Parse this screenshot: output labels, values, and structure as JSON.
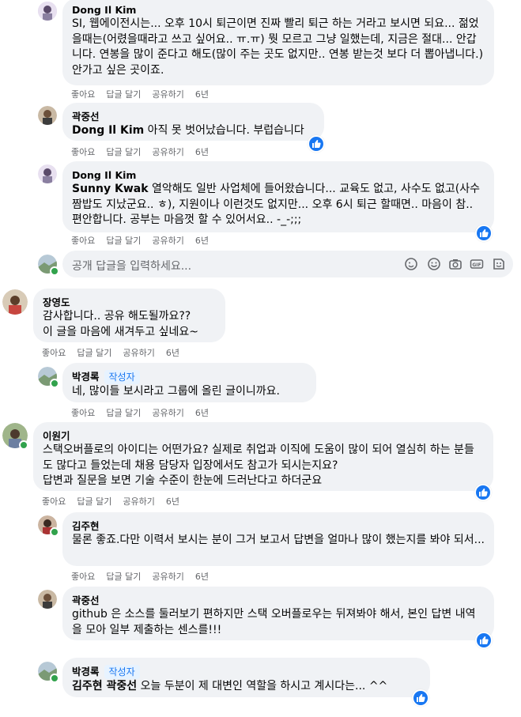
{
  "comments": [
    {
      "author": "Dong Il Kim",
      "text": "SI, 웹에이전시는... 오후 10시 퇴근이면 진짜 빨리 퇴근 하는 거라고 보시면 되요... 젊었을때는(어렸을때라고 쓰고 싶어요.. ㅠ.ㅠ) 뭣 모르고 그냥 일했는데, 지금은 절대... 안갑니다. 연봉을 많이 준다고 해도(많이 주는 곳도 없지만.. 연봉 받는것 보다 더 뽑아냅니다.) 안가고 싶은 곳이죠.",
      "actions": [
        "좋아요",
        "답글 달기",
        "공유하기"
      ],
      "time": "6년"
    },
    {
      "author": "곽중선",
      "mention": "Dong Il Kim",
      "text": " 아직 못 벗어났습니다. 부럽습니다",
      "actions": [
        "좋아요",
        "답글 달기",
        "공유하기"
      ],
      "time": "6년"
    },
    {
      "author": "Dong Il Kim",
      "mention": "Sunny Kwak",
      "text": " 열악해도 일반 사업체에 들어왔습니다... 교육도 없고, 사수도 없고(사수 짬밥도 지났군요.. ㅎ), 지원이나 이런것도 없지만... 오후 6시 퇴근 할때면.. 마음이 참.. 편안합니다. 공부는 마음껏 할 수 있어서요.. -_-;;;",
      "actions": [
        "좋아요",
        "답글 달기",
        "공유하기"
      ],
      "time": "6년"
    },
    {
      "author": "장영도",
      "text": "감사합니다.. 공유 해도될까요??\n이 글을 마음에 새겨두고 싶네요~",
      "actions": [
        "좋아요",
        "답글 달기",
        "공유하기"
      ],
      "time": "6년"
    },
    {
      "author": "박경록",
      "badge": "작성자",
      "text": "네, 많이들 보시라고 그룹에 올린 글이니까요.",
      "actions": [
        "좋아요",
        "답글 달기",
        "공유하기"
      ],
      "time": "6년"
    },
    {
      "author": "이원기",
      "text": "스택오버플로의 아이디는 어떤가요? 실제로 취업과 이직에 도움이 많이 되어 열심히 하는 분들도 많다고 들었는데 채용 담당자 입장에서도 참고가 되시는지요?\n답변과 질문을 보면 기술 수준이 한눈에 드러난다고 하더군요",
      "actions": [
        "좋아요",
        "답글 달기",
        "공유하기"
      ],
      "time": "6년"
    },
    {
      "author": "김주현",
      "text": "물론 좋죠.다만 이력서 보시는 분이 그거 보고서 답변을 얼마나 많이 했는지를 봐야 되서...",
      "actions": [
        "좋아요",
        "답글 달기",
        "공유하기"
      ],
      "time": "6년"
    },
    {
      "author": "곽중선",
      "text": "github 은 소스를 둘러보기 편하지만 스택 오버플로우는 뒤져봐야 해서, 본인 답변 내역을 모아 일부 제출하는 센스를!!!",
      "actions": [
        "좋아요",
        "답글 달기",
        "공유하기"
      ],
      "time": "6년"
    },
    {
      "author": "박경록",
      "badge": "작성자",
      "mention": "김주현 곽중선",
      "text": " 오늘 두분이 제 대변인 역할을 하시고 계시다는... ^^"
    }
  ],
  "reply_box": {
    "placeholder": "공개 답글을 입력하세요..."
  },
  "colors": {
    "bubble": "#f0f2f5",
    "like": "#1877f2",
    "muted": "#65676b",
    "online": "#31a24c"
  }
}
